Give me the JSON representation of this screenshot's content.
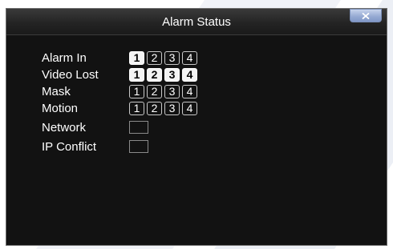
{
  "window": {
    "title": "Alarm Status"
  },
  "rows": [
    {
      "label": "Alarm In",
      "channels": [
        {
          "num": "1",
          "active": true
        },
        {
          "num": "2",
          "active": false
        },
        {
          "num": "3",
          "active": false
        },
        {
          "num": "4",
          "active": false
        }
      ]
    },
    {
      "label": "Video Lost",
      "channels": [
        {
          "num": "1",
          "active": true
        },
        {
          "num": "2",
          "active": true
        },
        {
          "num": "3",
          "active": true
        },
        {
          "num": "4",
          "active": true
        }
      ]
    },
    {
      "label": "Mask",
      "channels": [
        {
          "num": "1",
          "active": false
        },
        {
          "num": "2",
          "active": false
        },
        {
          "num": "3",
          "active": false
        },
        {
          "num": "4",
          "active": false
        }
      ]
    },
    {
      "label": "Motion",
      "channels": [
        {
          "num": "1",
          "active": false
        },
        {
          "num": "2",
          "active": false
        },
        {
          "num": "3",
          "active": false
        },
        {
          "num": "4",
          "active": false
        }
      ]
    }
  ],
  "network": {
    "label": "Network",
    "active": false
  },
  "ip_conflict": {
    "label": "IP Conflict",
    "active": false
  }
}
